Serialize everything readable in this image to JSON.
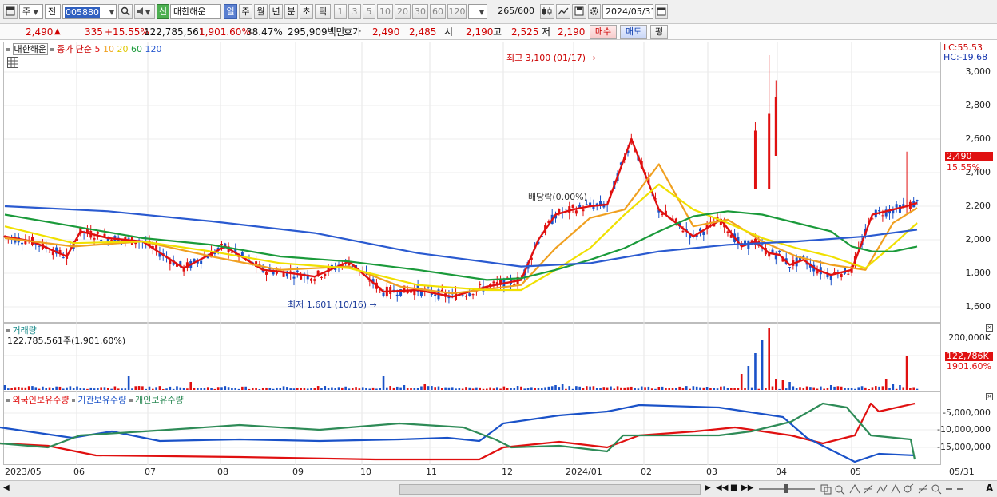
{
  "toolbar": {
    "market_type": "주",
    "market_scope": "전",
    "stock_code": "005880",
    "market_badge": "신",
    "stock_name": "대한해운",
    "periods": [
      "일",
      "주",
      "월",
      "년",
      "분",
      "초",
      "틱"
    ],
    "active_period": "일",
    "intervals": [
      "1",
      "3",
      "5",
      "10",
      "20",
      "30",
      "60",
      "120"
    ],
    "count_display": "265",
    "count_max": "/600",
    "date": "2024/05/31"
  },
  "quote": {
    "price": "2,490",
    "change": "335",
    "change_pct": "+15.55%",
    "volume": "122,785,561",
    "volume_ratio": "1,901.60%",
    "turnover": "38.47%",
    "amount": "295,909백만",
    "bid_label": "호가",
    "ask": "2,490",
    "bid": "2,485",
    "open_label": "시",
    "open": "2,190",
    "high_label": "고",
    "high": "2,525",
    "low_label": "저",
    "low": "2,190",
    "buy_button": "매수",
    "sell_button": "매도",
    "eval_button": "평"
  },
  "price_panel": {
    "stock_name": "대한해운",
    "ma_label": "종가 단순",
    "ma_periods": [
      "5",
      "10",
      "20",
      "60",
      "120"
    ],
    "ma_colors": [
      "#e01010",
      "#f0a020",
      "#f0e000",
      "#1a9a3a",
      "#2a5ad0"
    ],
    "lc": "LC:55.53",
    "hc": "HC:-19.68",
    "y_ticks": [
      "3,000",
      "2,800",
      "2,600",
      "2,400",
      "2,200",
      "2,000",
      "1,800",
      "1,600"
    ],
    "current_price_tag": "2,490",
    "current_change_tag": "15.55%",
    "high_annotation": "최고 3,100 (01/17)",
    "low_annotation": "최저 1,601 (10/16)",
    "dividend_annotation": "배당락(0.00%)"
  },
  "volume_panel": {
    "title": "거래량",
    "subtitle": "122,785,561주(1,901.60%)",
    "y_tick": "200,000K",
    "current_tag": "122,786K",
    "current_pct_tag": "1901.60%"
  },
  "holding_panel": {
    "series": [
      {
        "name": "외국인보유수량",
        "color": "#e01010"
      },
      {
        "name": "기관보유수량",
        "color": "#1a52c8"
      },
      {
        "name": "개인보유수량",
        "color": "#2e8b57"
      }
    ],
    "y_ticks": [
      "-5,000,000",
      "-10,000,000",
      "-15,000,000"
    ]
  },
  "x_axis": {
    "labels": [
      "2023/05",
      "06",
      "07",
      "08",
      "09",
      "10",
      "11",
      "12",
      "2024/01",
      "02",
      "03",
      "04",
      "05"
    ],
    "end_label": "05/31"
  },
  "chart_data": {
    "type": "line",
    "title": "대한해운",
    "x_range": [
      "2023/05",
      "2024/05/31"
    ],
    "ylim": [
      1500,
      3150
    ],
    "series": [
      {
        "name": "5",
        "values_x": [
          0,
          8,
          18,
          22,
          30,
          40,
          52,
          64,
          75,
          80,
          90,
          100,
          110,
          120,
          130,
          140,
          150,
          155,
          160,
          165,
          170,
          175,
          182,
          190,
          200,
          208,
          214,
          218,
          222,
          225,
          228,
          232,
          236,
          240,
          246,
          252,
          258,
          262,
          265
        ],
        "values": [
          2020,
          1990,
          1900,
          2050,
          2010,
          1990,
          1830,
          1960,
          1820,
          1810,
          1780,
          1870,
          1690,
          1700,
          1660,
          1720,
          1760,
          2000,
          2150,
          2180,
          2200,
          2210,
          2600,
          2180,
          2020,
          2120,
          1960,
          1990,
          1920,
          1910,
          1850,
          1880,
          1820,
          1790,
          1820,
          2150,
          2180,
          2200,
          2220
        ]
      },
      {
        "name": "10",
        "values_x": [
          0,
          20,
          40,
          60,
          80,
          100,
          115,
          130,
          150,
          160,
          170,
          180,
          190,
          200,
          210,
          220,
          230,
          240,
          250,
          258,
          265
        ],
        "values": [
          2010,
          1960,
          1990,
          1900,
          1820,
          1840,
          1720,
          1680,
          1730,
          1950,
          2130,
          2180,
          2450,
          2080,
          2120,
          1990,
          1900,
          1850,
          1820,
          2100,
          2190
        ]
      },
      {
        "name": "20",
        "values_x": [
          0,
          20,
          40,
          60,
          80,
          100,
          120,
          140,
          150,
          160,
          170,
          180,
          190,
          200,
          210,
          220,
          230,
          240,
          250,
          258,
          265
        ],
        "values": [
          2080,
          1980,
          1990,
          1930,
          1860,
          1830,
          1730,
          1700,
          1700,
          1820,
          1950,
          2150,
          2330,
          2180,
          2100,
          2010,
          1950,
          1900,
          1830,
          1970,
          2100
        ]
      },
      {
        "name": "60",
        "values_x": [
          0,
          20,
          40,
          60,
          80,
          100,
          120,
          140,
          150,
          160,
          170,
          180,
          190,
          200,
          210,
          220,
          230,
          240,
          246,
          252,
          258,
          265
        ],
        "values": [
          2150,
          2080,
          2010,
          1970,
          1900,
          1870,
          1820,
          1760,
          1770,
          1820,
          1880,
          1950,
          2050,
          2140,
          2170,
          2150,
          2100,
          2050,
          1960,
          1930,
          1930,
          1960
        ]
      },
      {
        "name": "120",
        "values_x": [
          0,
          30,
          60,
          90,
          120,
          150,
          170,
          190,
          210,
          230,
          250,
          265
        ],
        "values": [
          2200,
          2170,
          2110,
          2040,
          1920,
          1840,
          1860,
          1930,
          1970,
          1990,
          2020,
          2060
        ]
      }
    ],
    "annotations": [
      {
        "label": "최고 3,100 (01/17)",
        "value": 3100
      },
      {
        "label": "최저 1,601 (10/16)",
        "value": 1601
      }
    ]
  }
}
